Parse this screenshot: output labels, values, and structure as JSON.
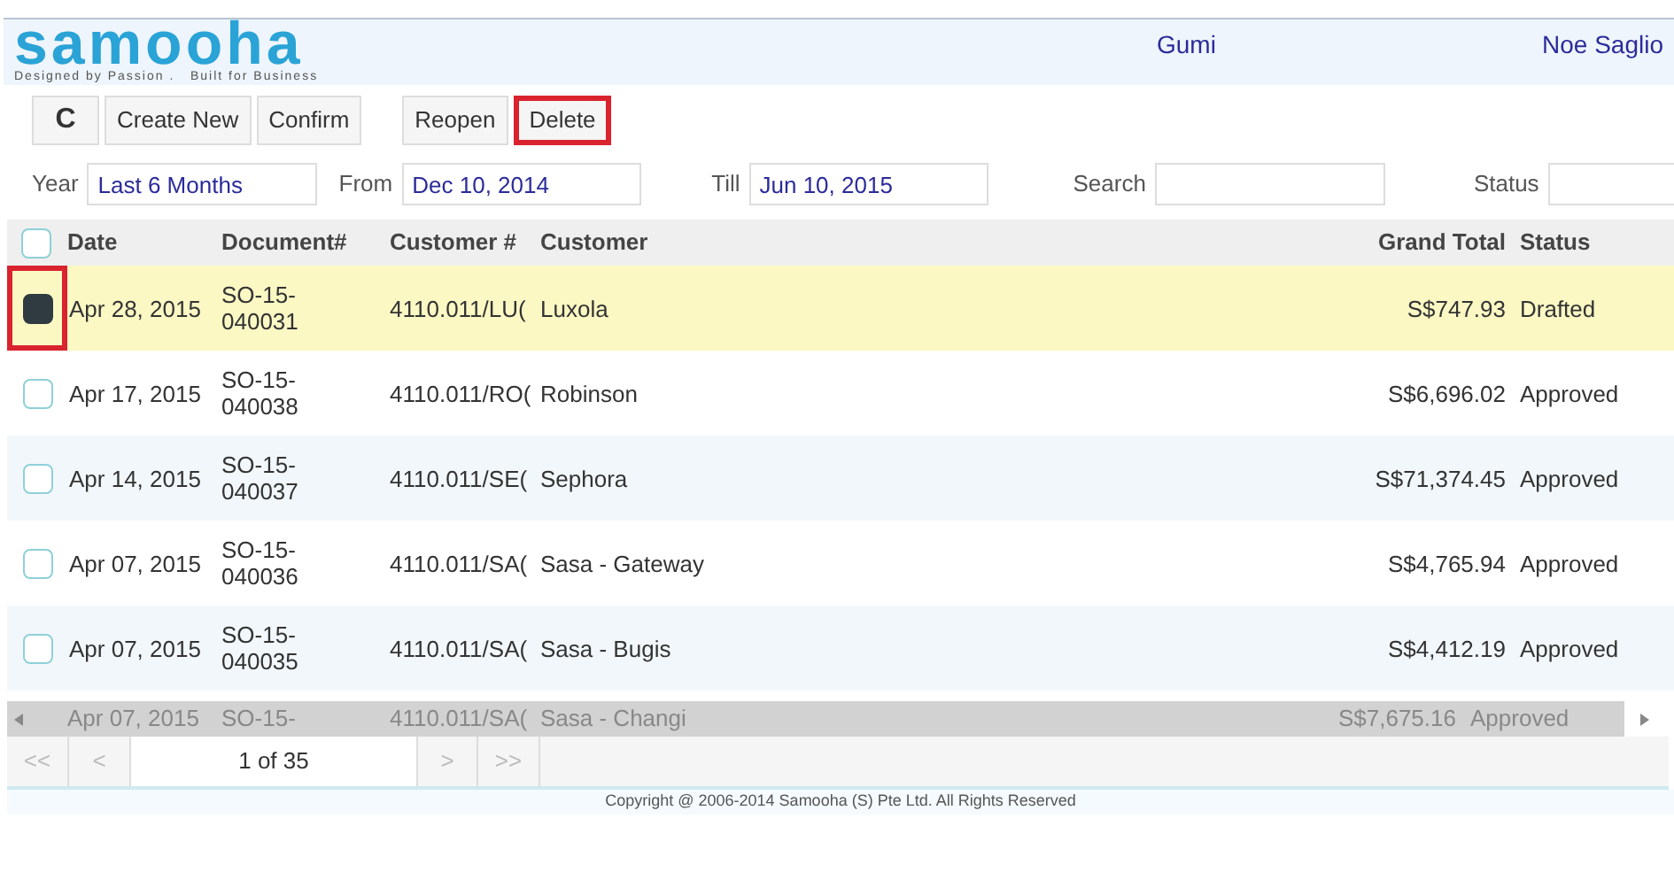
{
  "logo": {
    "name": "samooha",
    "tagline": "Designed by Passion .   Built for Business"
  },
  "header": {
    "company": "Gumi",
    "user": "Noe Saglio"
  },
  "toolbar": [
    {
      "kind": "refresh",
      "label": "C",
      "highlighted": false
    },
    {
      "kind": "text",
      "label": "Create New",
      "highlighted": false
    },
    {
      "kind": "text",
      "label": "Confirm",
      "highlighted": false
    },
    {
      "kind": "text",
      "label": "Reopen",
      "highlighted": false
    },
    {
      "kind": "text",
      "label": "Delete",
      "highlighted": true
    }
  ],
  "filters": [
    {
      "label": "Year",
      "value": "Last 6 Months"
    },
    {
      "label": "From",
      "value": "Dec 10, 2014"
    },
    {
      "label": "Till",
      "value": "Jun 10, 2015"
    },
    {
      "label": "Search"
    },
    {
      "label": "Status"
    }
  ],
  "table": {
    "all_selected": false,
    "columns": [
      "Date",
      "Document#",
      "Customer #",
      "Customer",
      "Grand Total",
      "Status"
    ],
    "rows": [
      {
        "selected": true,
        "highlighted": true,
        "cells": [
          "Apr 28, 2015",
          "SO-15-\n040031",
          "4110.011/LU(",
          "Luxola",
          "S$747.93",
          "Drafted"
        ]
      },
      {
        "selected": false,
        "highlighted": false,
        "cells": [
          "Apr 17, 2015",
          "SO-15-\n040038",
          "4110.011/RO(",
          "Robinson",
          "S$6,696.02",
          "Approved"
        ]
      },
      {
        "selected": false,
        "highlighted": false,
        "cells": [
          "Apr 14, 2015",
          "SO-15-\n040037",
          "4110.011/SE(",
          "Sephora",
          "S$71,374.45",
          "Approved"
        ]
      },
      {
        "selected": false,
        "highlighted": false,
        "cells": [
          "Apr 07, 2015",
          "SO-15-\n040036",
          "4110.011/SA(",
          "Sasa - Gateway",
          "S$4,765.94",
          "Approved"
        ]
      },
      {
        "selected": false,
        "highlighted": false,
        "cells": [
          "Apr 07, 2015",
          "SO-15-\n040035",
          "4110.011/SA(",
          "Sasa - Bugis",
          "S$4,412.19",
          "Approved"
        ]
      }
    ],
    "partial_row": {
      "cells": [
        "Apr 07, 2015",
        "SO-15-",
        "4110.011/SA(",
        "Sasa - Changi",
        "S$7,675.16",
        "Approved"
      ]
    }
  },
  "pager": {
    "first": "<<",
    "prev": "<",
    "page": "1 of 35",
    "next": ">",
    "last": ">>"
  },
  "footer": "Copyright @ 2006-2014 Samooha (S) Pte Ltd. All Rights Reserved"
}
